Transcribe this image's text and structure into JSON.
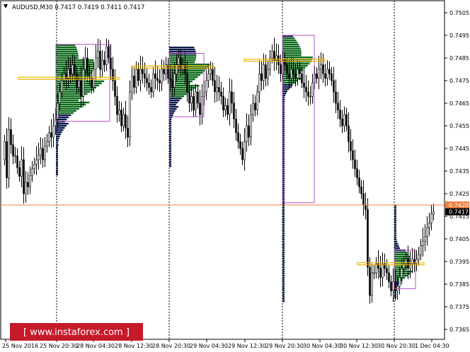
{
  "header": {
    "symbol_line": "AUDUSD,M30  0.7417 0.7419 0.7411 0.7417"
  },
  "watermark": {
    "text": "[ www.instaforex.com ]"
  },
  "price_tags": {
    "level": "0.7420",
    "current": "0.7417"
  },
  "colors": {
    "background": "#ffffff",
    "candle": "#000000",
    "profile_green": "#0e6b1c",
    "profile_navy": "#0b1a4a",
    "value_area_box": "#b050c8",
    "poc_line": "#f0b400",
    "level_line": "#f07f3c",
    "watermark_bg": "#c61a2a"
  },
  "chart_data": {
    "type": "candlestick",
    "symbol": "AUDUSD",
    "timeframe": "M30",
    "ohlc_header": {
      "open": 0.7417,
      "high": 0.7419,
      "low": 0.7411,
      "close": 0.7417
    },
    "ylim": [
      0.7365,
      0.7505
    ],
    "y_ticks": [
      "0.7505",
      "0.7495",
      "0.7485",
      "0.7475",
      "0.7465",
      "0.7455",
      "0.7445",
      "0.7435",
      "0.7425",
      "0.7415",
      "0.7405",
      "0.7395",
      "0.7385",
      "0.7375",
      "0.7365"
    ],
    "x_ticks": [
      "25 Nov 2016",
      "25 Nov 20:30",
      "28 Nov 04:30",
      "28 Nov 12:30",
      "28 Nov 20:30",
      "29 Nov 04:30",
      "29 Nov 12:30",
      "29 Nov 20:30",
      "30 Nov 04:30",
      "30 Nov 12:30",
      "30 Nov 20:30",
      "1 Dec 04:30"
    ],
    "horizontal_level": 0.742,
    "current_price": 0.7417,
    "grid": false,
    "session_separators": [
      "25 Nov 20:30",
      "28 Nov 20:30",
      "29 Nov 20:30",
      "30 Nov 20:30"
    ],
    "price_path": [
      [
        0,
        0.744
      ],
      [
        3,
        0.7448
      ],
      [
        6,
        0.7432
      ],
      [
        8,
        0.7455
      ],
      [
        11,
        0.745
      ],
      [
        14,
        0.744
      ],
      [
        17,
        0.7445
      ],
      [
        20,
        0.7435
      ],
      [
        22,
        0.7438
      ],
      [
        25,
        0.743
      ],
      [
        27,
        0.744
      ],
      [
        29,
        0.7428
      ],
      [
        31,
        0.7422
      ],
      [
        33,
        0.743
      ],
      [
        36,
        0.7428
      ],
      [
        39,
        0.7433
      ],
      [
        42,
        0.7436
      ],
      [
        45,
        0.7438
      ],
      [
        48,
        0.744
      ],
      [
        51,
        0.7442
      ],
      [
        54,
        0.7445
      ],
      [
        57,
        0.744
      ],
      [
        60,
        0.7446
      ],
      [
        63,
        0.7448
      ],
      [
        66,
        0.7452
      ],
      [
        69,
        0.745
      ],
      [
        72,
        0.7455
      ],
      [
        75,
        0.7458
      ],
      [
        78,
        0.7465
      ],
      [
        81,
        0.747
      ],
      [
        84,
        0.7475
      ],
      [
        87,
        0.7478
      ],
      [
        90,
        0.7476
      ],
      [
        93,
        0.748
      ],
      [
        96,
        0.7478
      ],
      [
        99,
        0.7482
      ],
      [
        102,
        0.7478
      ],
      [
        105,
        0.7472
      ],
      [
        108,
        0.7475
      ],
      [
        111,
        0.7468
      ],
      [
        114,
        0.748
      ],
      [
        117,
        0.7485
      ],
      [
        120,
        0.7478
      ],
      [
        123,
        0.7476
      ],
      [
        126,
        0.7472
      ],
      [
        129,
        0.748
      ],
      [
        132,
        0.7485
      ],
      [
        135,
        0.7488
      ],
      [
        138,
        0.748
      ],
      [
        141,
        0.7484
      ],
      [
        144,
        0.7482
      ],
      [
        147,
        0.749
      ],
      [
        150,
        0.7485
      ],
      [
        153,
        0.748
      ],
      [
        156,
        0.7475
      ],
      [
        159,
        0.7468
      ],
      [
        162,
        0.746
      ],
      [
        165,
        0.7462
      ],
      [
        168,
        0.7455
      ],
      [
        171,
        0.746
      ],
      [
        174,
        0.7454
      ],
      [
        177,
        0.745
      ],
      [
        180,
        0.747
      ],
      [
        183,
        0.7477
      ],
      [
        186,
        0.7472
      ],
      [
        189,
        0.748
      ],
      [
        192,
        0.7475
      ],
      [
        195,
        0.748
      ],
      [
        198,
        0.7478
      ],
      [
        201,
        0.7476
      ],
      [
        204,
        0.7474
      ],
      [
        207,
        0.7472
      ],
      [
        210,
        0.747
      ],
      [
        213,
        0.7478
      ],
      [
        216,
        0.7476
      ],
      [
        219,
        0.7475
      ],
      [
        222,
        0.7474
      ],
      [
        225,
        0.748
      ],
      [
        228,
        0.7478
      ],
      [
        231,
        0.7482
      ],
      [
        234,
        0.7476
      ],
      [
        237,
        0.7475
      ],
      [
        240,
        0.7472
      ],
      [
        243,
        0.7478
      ],
      [
        246,
        0.7482
      ],
      [
        249,
        0.7485
      ],
      [
        252,
        0.748
      ],
      [
        255,
        0.7482
      ],
      [
        258,
        0.7478
      ],
      [
        261,
        0.747
      ],
      [
        264,
        0.7465
      ],
      [
        267,
        0.7468
      ],
      [
        270,
        0.7462
      ],
      [
        273,
        0.747
      ],
      [
        276,
        0.7465
      ],
      [
        279,
        0.746
      ],
      [
        282,
        0.7468
      ],
      [
        285,
        0.747
      ],
      [
        288,
        0.7475
      ],
      [
        291,
        0.7478
      ],
      [
        294,
        0.748
      ],
      [
        297,
        0.7475
      ],
      [
        300,
        0.747
      ],
      [
        303,
        0.7472
      ],
      [
        306,
        0.747
      ],
      [
        309,
        0.7468
      ],
      [
        312,
        0.7462
      ],
      [
        315,
        0.7464
      ],
      [
        318,
        0.746
      ],
      [
        321,
        0.747
      ],
      [
        324,
        0.7465
      ],
      [
        327,
        0.7458
      ],
      [
        330,
        0.7452
      ],
      [
        333,
        0.7448
      ],
      [
        336,
        0.7445
      ],
      [
        339,
        0.744
      ],
      [
        342,
        0.7448
      ],
      [
        345,
        0.7455
      ],
      [
        348,
        0.745
      ],
      [
        351,
        0.746
      ],
      [
        354,
        0.7465
      ],
      [
        357,
        0.7462
      ],
      [
        360,
        0.747
      ],
      [
        363,
        0.7478
      ],
      [
        366,
        0.7475
      ],
      [
        369,
        0.7482
      ],
      [
        372,
        0.7476
      ],
      [
        375,
        0.748
      ],
      [
        378,
        0.7485
      ],
      [
        381,
        0.7488
      ],
      [
        384,
        0.7484
      ],
      [
        387,
        0.7486
      ],
      [
        390,
        0.7482
      ],
      [
        393,
        0.7478
      ],
      [
        396,
        0.7484
      ],
      [
        399,
        0.7482
      ],
      [
        402,
        0.7478
      ],
      [
        405,
        0.7476
      ],
      [
        408,
        0.748
      ],
      [
        411,
        0.7478
      ],
      [
        414,
        0.7476
      ],
      [
        417,
        0.748
      ],
      [
        420,
        0.7478
      ],
      [
        423,
        0.7474
      ],
      [
        426,
        0.7472
      ],
      [
        429,
        0.747
      ],
      [
        432,
        0.7468
      ],
      [
        435,
        0.7468
      ],
      [
        438,
        0.7474
      ],
      [
        441,
        0.7478
      ],
      [
        444,
        0.7476
      ],
      [
        447,
        0.748
      ],
      [
        450,
        0.7482
      ],
      [
        453,
        0.7478
      ],
      [
        456,
        0.7476
      ],
      [
        459,
        0.748
      ],
      [
        462,
        0.7478
      ],
      [
        465,
        0.7475
      ],
      [
        468,
        0.747
      ],
      [
        471,
        0.7465
      ],
      [
        474,
        0.7462
      ],
      [
        477,
        0.7458
      ],
      [
        480,
        0.7455
      ],
      [
        483,
        0.746
      ],
      [
        486,
        0.7455
      ],
      [
        489,
        0.7448
      ],
      [
        492,
        0.7444
      ],
      [
        495,
        0.744
      ],
      [
        498,
        0.7436
      ],
      [
        501,
        0.7432
      ],
      [
        504,
        0.7428
      ],
      [
        507,
        0.7425
      ],
      [
        510,
        0.742
      ],
      [
        513,
        0.7418
      ],
      [
        515,
        0.74
      ],
      [
        517,
        0.7385
      ],
      [
        519,
        0.738
      ],
      [
        521,
        0.7388
      ],
      [
        523,
        0.7392
      ],
      [
        525,
        0.739
      ],
      [
        528,
        0.7394
      ],
      [
        531,
        0.7392
      ],
      [
        534,
        0.7388
      ],
      [
        537,
        0.7394
      ],
      [
        540,
        0.7392
      ],
      [
        543,
        0.739
      ],
      [
        546,
        0.7386
      ],
      [
        549,
        0.7382
      ],
      [
        552,
        0.7386
      ],
      [
        555,
        0.7382
      ],
      [
        558,
        0.7384
      ],
      [
        561,
        0.7388
      ],
      [
        564,
        0.7392
      ],
      [
        567,
        0.7394
      ],
      [
        570,
        0.7396
      ],
      [
        573,
        0.7392
      ],
      [
        576,
        0.7394
      ],
      [
        579,
        0.7396
      ],
      [
        582,
        0.7394
      ],
      [
        585,
        0.7396
      ],
      [
        588,
        0.7398
      ],
      [
        591,
        0.7402
      ],
      [
        594,
        0.7404
      ],
      [
        597,
        0.7406
      ],
      [
        600,
        0.741
      ],
      [
        603,
        0.7412
      ],
      [
        606,
        0.7416
      ],
      [
        609,
        0.7417
      ]
    ],
    "volume_profiles": [
      {
        "session": "25 Nov 20:30 - 28 Nov 04:30",
        "value_area": [
          0.7457,
          0.7491
        ],
        "poc": 0.7476,
        "range": [
          0.7433,
          0.7491
        ]
      },
      {
        "session": "28 Nov 20:30 - 29 Nov 04:30",
        "value_area": [
          0.7459,
          0.7487
        ],
        "poc": 0.7481,
        "range": [
          0.7437,
          0.749
        ]
      },
      {
        "session": "29 Nov 20:30 - 30 Nov 04:30",
        "value_area": [
          0.7421,
          0.7495
        ],
        "poc": 0.7484,
        "range": [
          0.7377,
          0.7495
        ]
      },
      {
        "session": "30 Nov 20:30 - 1 Dec 04:30",
        "value_area": [
          0.7383,
          0.74
        ],
        "poc": 0.7394,
        "range": [
          0.7379,
          0.742
        ]
      }
    ]
  }
}
